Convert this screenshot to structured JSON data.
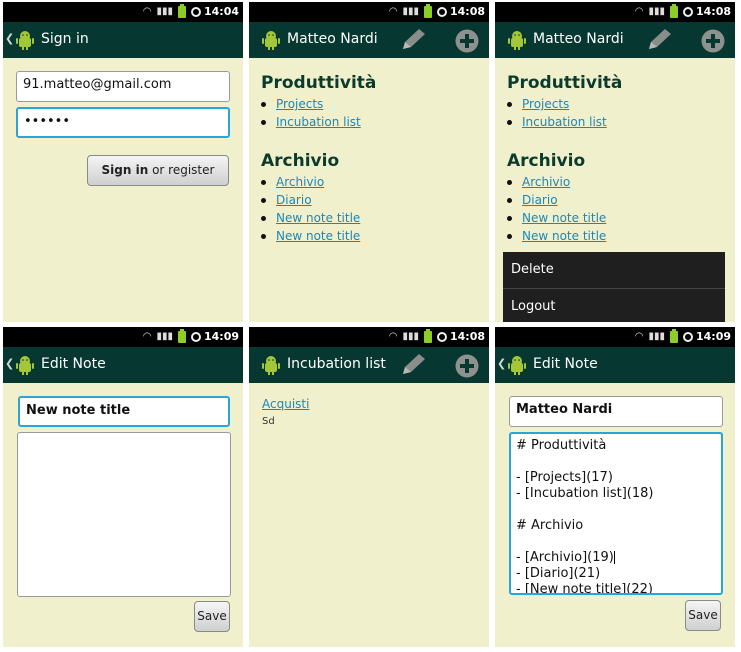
{
  "screens": [
    {
      "time": "14:04",
      "title": "Sign in",
      "email_value": "91.matteo@gmail.com",
      "password_value": "••••••",
      "signin_bold": "Sign in",
      "signin_rest": " or register"
    },
    {
      "time": "14:08",
      "title": "Matteo Nardi",
      "section1_title": "Produttività",
      "section1_links": [
        "Projects",
        "Incubation list"
      ],
      "section2_title": "Archivio",
      "section2_links": [
        "Archivio",
        "Diario",
        "New note title",
        "New note title"
      ]
    },
    {
      "time": "14:08",
      "title": "Matteo Nardi",
      "section1_title": "Produttività",
      "section1_links": [
        "Projects",
        "Incubation list"
      ],
      "section2_title": "Archivio",
      "section2_links": [
        "Archivio",
        "Diario",
        "New note title",
        "New note title"
      ],
      "menu_items": [
        "Delete",
        "Logout"
      ]
    },
    {
      "time": "14:09",
      "title": "Edit Note",
      "title_value": "New note title",
      "body_value": "",
      "save_label": "Save"
    },
    {
      "time": "14:08",
      "title": "Incubation list",
      "link": "Acquisti",
      "text": "Sd"
    },
    {
      "time": "14:09",
      "title": "Edit Note",
      "title_value": "Matteo Nardi",
      "body_lines": [
        "# Produttività",
        "",
        "- [Projects](17)",
        "- [Incubation list](18)",
        "",
        "# Archivio",
        "",
        "- [Archivio](19)",
        "- [Diario](21)",
        "- [New note title](22)"
      ],
      "save_label": "Save"
    }
  ],
  "colors": {
    "background": "#f1f0cd",
    "titlebar": "#063731",
    "link": "#1c87b8",
    "heading": "#0b3b2c",
    "focus_border": "#2aa4dc",
    "menu": "#1f1f1f"
  }
}
